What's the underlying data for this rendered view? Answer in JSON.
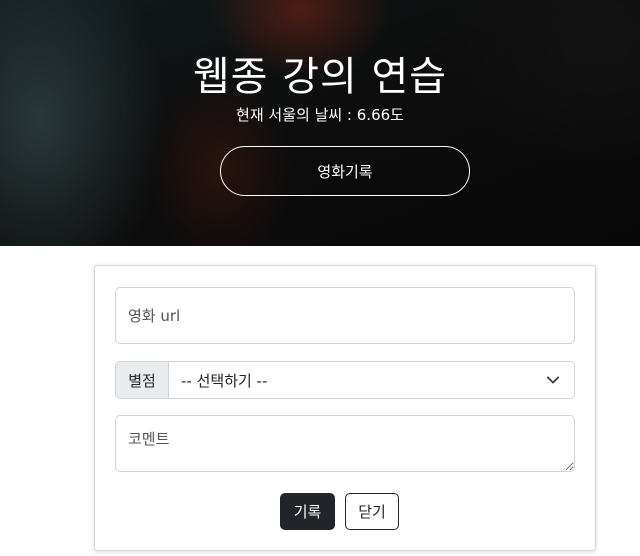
{
  "hero": {
    "title": "웹종 강의 연습",
    "weather": "현재 서울의 날씨 : 6.66도",
    "record_button": "영화기록"
  },
  "form": {
    "url_placeholder": "영화 url",
    "url_value": "",
    "rating_label": "별점",
    "rating_selected": "-- 선택하기 --",
    "comment_placeholder": "코멘트",
    "comment_value": "",
    "submit_label": "기록",
    "close_label": "닫기"
  },
  "colors": {
    "dark_button": "#212529",
    "border": "#ced4da",
    "label_bg": "#e9ecef"
  },
  "icons": {
    "select_chevron": "chevron-down-icon"
  }
}
